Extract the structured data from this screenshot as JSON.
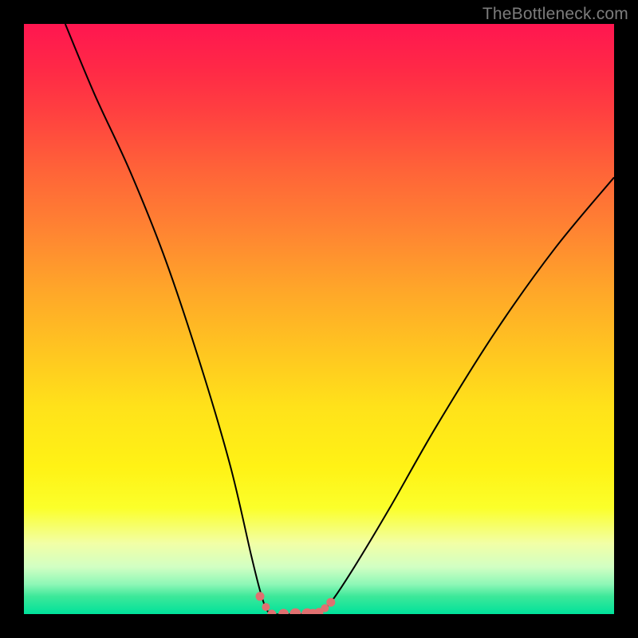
{
  "watermark": {
    "text": "TheBottleneck.com"
  },
  "chart_data": {
    "type": "line",
    "title": "",
    "xlabel": "",
    "ylabel": "",
    "xlim": [
      0,
      100
    ],
    "ylim": [
      0,
      100
    ],
    "grid": false,
    "legend": false,
    "series": [
      {
        "name": "curve",
        "x": [
          7,
          12,
          18,
          24,
          30,
          35,
          38.5,
          40,
          41,
          42,
          44,
          47,
          50,
          52,
          56,
          62,
          70,
          80,
          90,
          100
        ],
        "values": [
          100,
          88,
          75,
          60,
          42,
          25,
          10,
          4,
          1,
          0,
          0,
          0,
          0.5,
          2,
          8,
          18,
          32,
          48,
          62,
          74
        ]
      }
    ],
    "markers": {
      "name": "dots",
      "color": "#e07070",
      "x": [
        40,
        41,
        42,
        44,
        46,
        48,
        49,
        50,
        51,
        52
      ],
      "values": [
        3.0,
        1.2,
        0,
        0,
        0,
        0,
        0,
        0.3,
        1.0,
        2.0
      ],
      "sizes": [
        5.5,
        5.0,
        5.5,
        6.5,
        7.2,
        7.2,
        6.5,
        5.5,
        5.0,
        5.5
      ]
    },
    "background_gradient": {
      "direction": "vertical",
      "stops": [
        {
          "pos": 0,
          "color": "#ff1650"
        },
        {
          "pos": 15,
          "color": "#ff4040"
        },
        {
          "pos": 35,
          "color": "#ff8432"
        },
        {
          "pos": 55,
          "color": "#ffc421"
        },
        {
          "pos": 75,
          "color": "#fff215"
        },
        {
          "pos": 92,
          "color": "#d2ffc3"
        },
        {
          "pos": 100,
          "color": "#00e29b"
        }
      ]
    }
  }
}
